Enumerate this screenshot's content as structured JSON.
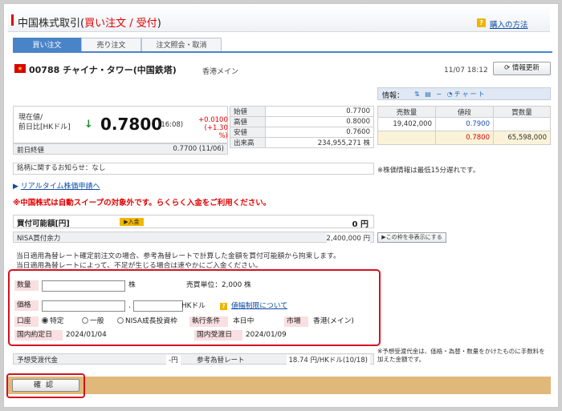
{
  "header": {
    "title_prefix": "中国株式取引(",
    "title_highlight": "買い注文 / 受付",
    "title_suffix": ")",
    "help_icon_glyph": "?",
    "help_link": "購入の方法"
  },
  "tabs": [
    {
      "label": "買い注文",
      "active": true
    },
    {
      "label": "売り注文",
      "active": false
    },
    {
      "label": "注文照会・取消",
      "active": false
    }
  ],
  "stock": {
    "flag_glyph": "★",
    "code_name": "00788 チャイナ・タワー(中国鉄塔)",
    "market": "香港メイン",
    "timestamp": "11/07 18:12",
    "refresh_label": "情報更新"
  },
  "quote": {
    "label_line1": "現在値/",
    "label_line2": "前日比[HKドル]",
    "arrow": "↓",
    "price": "0.7800",
    "time": "(16:08)",
    "change_line1": "+0.0100",
    "change_line2": "(+1.30 %)",
    "prev_close_label": "前日終値",
    "prev_close_value": "0.7700 (11/06)",
    "stats": [
      {
        "label": "始値",
        "value": "0.7700"
      },
      {
        "label": "高値",
        "value": "0.8000"
      },
      {
        "label": "安値",
        "value": "0.7600"
      },
      {
        "label": "出来高",
        "value": "234,955,271 株"
      }
    ]
  },
  "board": {
    "info_label": "情報：",
    "info_icons": "⇅ ▤ ∼ ◔チャート",
    "headers": [
      "売数量",
      "値段",
      "買数量"
    ],
    "rows": [
      {
        "sell": "19,402,000",
        "price": "0.7900",
        "buy": ""
      },
      {
        "sell": "",
        "price": "0.7800",
        "buy": "65,598,000"
      }
    ]
  },
  "notes": {
    "delay": "※株価情報は最低15分遅れです。",
    "notice": "銘柄に関するお知らせ：なし",
    "realtime_prefix": "▶ ",
    "realtime_link": "リアルタイム株価申請へ",
    "sweep": "※中国株式は自動スイープの対象外です。らくらく入金をご利用ください。"
  },
  "buying_power": {
    "label": "買付可能額[円]",
    "deposit_btn": "▶入金",
    "value": "0 円",
    "nisa_label": "NISA買付余力",
    "nisa_value": "2,400,000 円",
    "hide_btn": "▶この枠を非表示にする"
  },
  "disclaimer": {
    "line1": "当日適用為替レート確定前注文の場合、参考為替レートで計算した金額を買付可能額から拘束します。",
    "line2": "当日適用為替レートによって、不足が生じる場合は速やかにご入金ください。"
  },
  "order_form": {
    "qty_label": "数量",
    "qty_value": "",
    "qty_unit": "株",
    "lot_label": "売買単位：2,000 株",
    "price_label": "価格",
    "price_int": "",
    "price_sep": ".",
    "price_dec": "",
    "price_unit": "HKドル",
    "limit_link": "値幅制限について",
    "account_label": "口座",
    "account_opt1": "特定",
    "account_opt2": "一般",
    "account_opt3": "NISA成長投資枠",
    "cond_label": "執行条件",
    "cond_value": "本日中",
    "market_label": "市場",
    "market_value": "香港(メイン)",
    "local_trade_label": "国内約定日",
    "local_trade_value": "2024/01/04",
    "local_settle_label": "国内受渡日",
    "local_settle_value": "2024/01/09"
  },
  "estimate": {
    "label": "予想受渡代金",
    "value": "-円",
    "rate_label": "参考為替レート",
    "rate_value": "18.74 円/HKドル(10/18)",
    "note_line1": "※予想受渡代金は、価格・為替・数量をかけたものに手数料を",
    "note_line2": "加えた金額です。"
  },
  "confirm_label": "確認",
  "colors": {
    "accent_red": "#e10000",
    "tab_blue": "#4a84c8",
    "highlight_red": "#d3121f",
    "bottom_bar": "#e0b879"
  }
}
